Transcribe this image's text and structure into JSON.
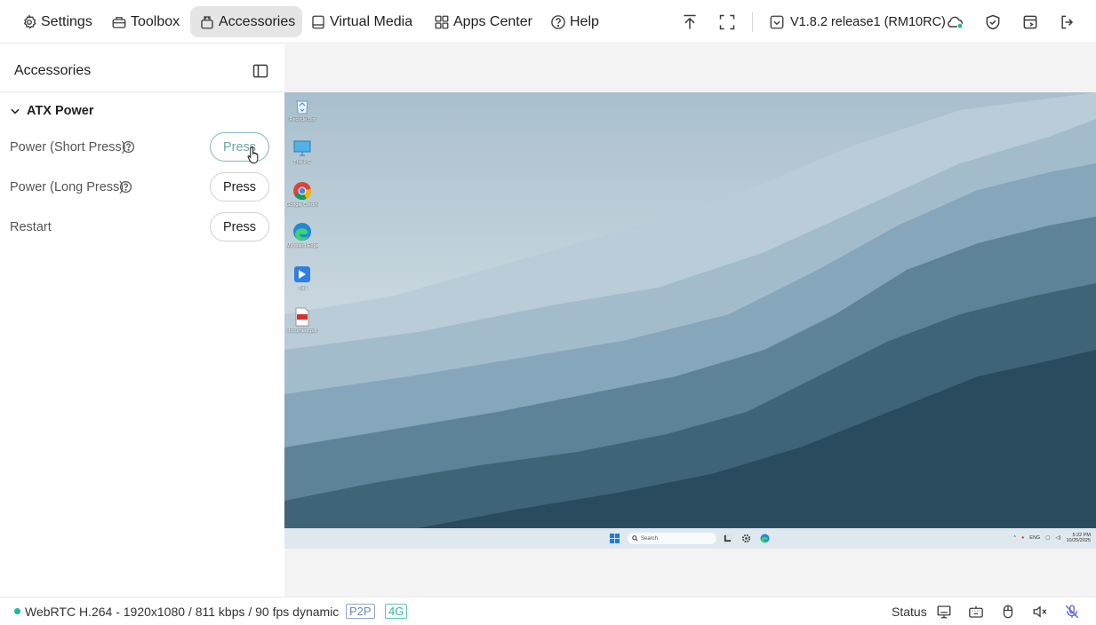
{
  "nav": {
    "settings": "Settings",
    "toolbox": "Toolbox",
    "accessories": "Accessories",
    "virtual_media": "Virtual Media",
    "apps_center": "Apps Center",
    "help": "Help"
  },
  "header": {
    "version": "V1.8.2 release1 (RM10RC)"
  },
  "sidebar": {
    "title": "Accessories",
    "group": "ATX Power",
    "items": [
      {
        "label": "Power (Short Press)",
        "button": "Press"
      },
      {
        "label": "Power (Long Press)",
        "button": "Press"
      },
      {
        "label": "Restart",
        "button": "Press"
      }
    ]
  },
  "remote": {
    "desktop_icons": [
      "Recycle Bin",
      "This PC",
      "Google Chrome",
      "Microsoft Edge",
      "Tool",
      "document.pdf"
    ],
    "taskbar_search": "Search",
    "tray_lang": "ENG",
    "tray_time": "5:22 PM",
    "tray_date": "10/25/2025"
  },
  "status": {
    "stream": "WebRTC H.264 - 1920x1080 / 811 kbps / 90 fps dynamic",
    "tag_p2p": "P2P",
    "tag_4g": "4G",
    "label": "Status"
  },
  "colors": {
    "accent": "#1fb89e",
    "active_nav_bg": "#e5e5e5",
    "p2p_tag": "#6f87b5",
    "g4_tag": "#2eb4a6"
  }
}
